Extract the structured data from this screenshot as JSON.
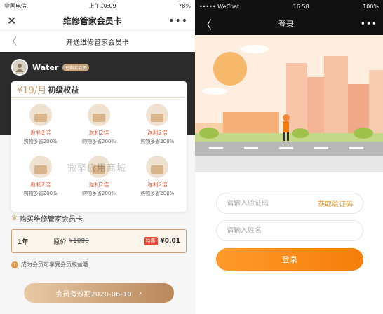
{
  "left": {
    "status_bar": {
      "carrier": "中国电信",
      "time": "上午10:09",
      "battery": "78%"
    },
    "nav": {
      "title": "维修管家会员卡",
      "close_glyph": "✕",
      "more_glyph": "•••"
    },
    "subnav": {
      "title": "开通维修管家会员卡",
      "back_glyph": "〈"
    },
    "user": {
      "name": "Water",
      "badge": "已购买会员"
    },
    "benefit": {
      "price": "¥19/月",
      "level": "初级权益",
      "items": [
        {
          "label": "返利2倍",
          "sub": "购物多省200%"
        },
        {
          "label": "返利2倍",
          "sub": "购物多省200%"
        },
        {
          "label": "返利2倍",
          "sub": "购物多省200%"
        },
        {
          "label": "返利2倍",
          "sub": "购物多省200%"
        },
        {
          "label": "返利2倍",
          "sub": "购物多省200%"
        },
        {
          "label": "返利2倍",
          "sub": "购物多省200%"
        }
      ],
      "watermark": "微擎应用商城"
    },
    "purchase": {
      "title": "购买维修管家会员卡",
      "plan": {
        "term": "1年",
        "orig_label": "原价",
        "orig_price": "¥1000",
        "sale_tag": "特惠",
        "sale_price": "¥0.01"
      },
      "notice": "成为会员可享受会员权益哦",
      "expiry_button": "会员有效期2020-06-10"
    },
    "icons": [
      "close-icon",
      "more-icon",
      "back-icon",
      "crown-icon",
      "info-icon",
      "chevron-right-icon"
    ]
  },
  "right": {
    "status_bar": {
      "carrier": "••••• WeChat",
      "time": "16:58",
      "battery": "100%"
    },
    "nav": {
      "title": "登录",
      "back_glyph": "〈",
      "more_glyph": "•••"
    },
    "form": {
      "code_placeholder": "请输入验证码",
      "get_code_label": "获取验证码",
      "name_placeholder": "请输入姓名",
      "login_button": "登录"
    }
  },
  "colors": {
    "accent_gold": "#c8a27a",
    "accent_orange": "#f57e0a",
    "sale_red": "#e84c3d"
  }
}
